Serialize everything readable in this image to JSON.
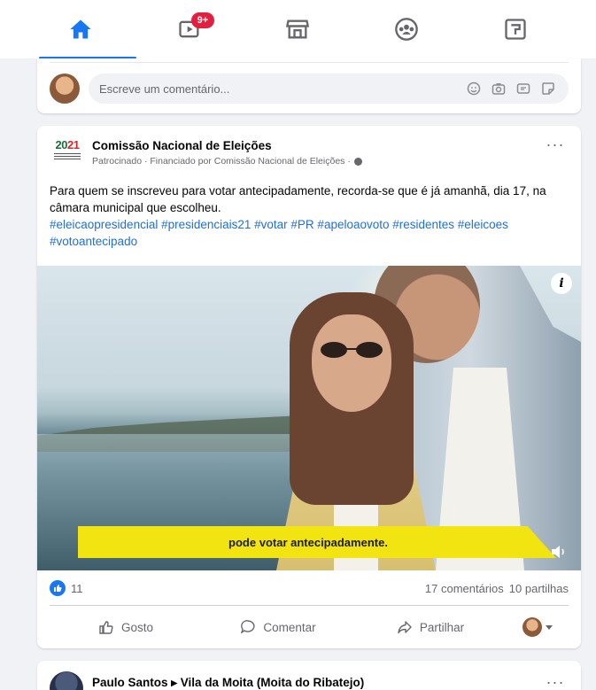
{
  "nav": {
    "tabs": [
      {
        "name": "home",
        "icon": "home-icon",
        "active": true
      },
      {
        "name": "watch",
        "icon": "video-icon",
        "badge": "9+"
      },
      {
        "name": "marketplace",
        "icon": "store-icon"
      },
      {
        "name": "groups",
        "icon": "groups-icon"
      },
      {
        "name": "gaming",
        "icon": "gaming-icon"
      }
    ],
    "watch_badge": "9+",
    "accent_color": "#1877f2",
    "badge_color": "#e41e3f"
  },
  "comment_composer": {
    "placeholder": "Escreve um comentário...",
    "icons": [
      "emoji-icon",
      "camera-icon",
      "gif-icon",
      "sticker-icon"
    ]
  },
  "post": {
    "page_logo_text": {
      "part1": "20",
      "part2": "21"
    },
    "page_name": "Comissão Nacional de Eleições",
    "sponsor_line": "Patrocinado · Financiado por Comissão Nacional de Eleições ·",
    "more_label": "···",
    "body": "Para quem se inscreveu para votar antecipadamente, recorda-se que é já amanhã, dia 17, na câmara municipal que escolheu.",
    "hashtags": "#eleicaopresidencial #presidenciais21 #votar #PR #apeloaovoto #residentes #eleicoes #votoantecipado",
    "video": {
      "info_label": "i",
      "caption": "pode votar antecipadamente."
    },
    "reactions_count": "11",
    "comments": "17 comentários",
    "shares": "10 partilhas",
    "actions": {
      "like": "Gosto",
      "comment": "Comentar",
      "share": "Partilhar"
    }
  },
  "next_post": {
    "header": "Paulo Santos ▸ Vila da Moita (Moita do Ribatejo)",
    "more_label": "···"
  }
}
